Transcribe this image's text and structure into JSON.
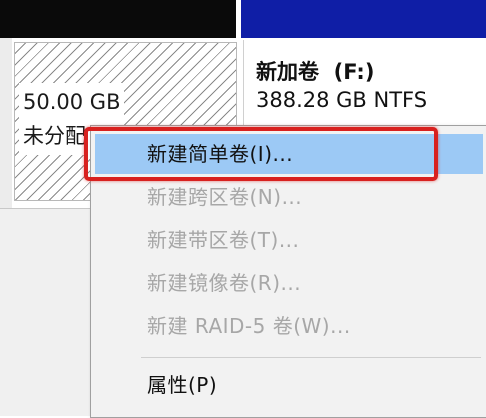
{
  "disk_map": {
    "unallocated": {
      "size": "50.00 GB",
      "status": "未分配"
    },
    "volume_f": {
      "name": "新加卷  (F:)",
      "size_fs": "388.28 GB NTFS"
    }
  },
  "context_menu": {
    "items": [
      {
        "label": "新建简单卷(I)...",
        "state": "selected"
      },
      {
        "label": "新建跨区卷(N)...",
        "state": "disabled"
      },
      {
        "label": "新建带区卷(T)...",
        "state": "disabled"
      },
      {
        "label": "新建镜像卷(R)...",
        "state": "disabled"
      },
      {
        "label": "新建 RAID-5 卷(W)...",
        "state": "disabled"
      }
    ],
    "properties_label": "属性(P)"
  },
  "colors": {
    "header_black": "#0a0a0a",
    "header_blue": "#0f1ea6",
    "menu_selection": "#9cc9f5",
    "annotation_red": "#d8211f"
  }
}
